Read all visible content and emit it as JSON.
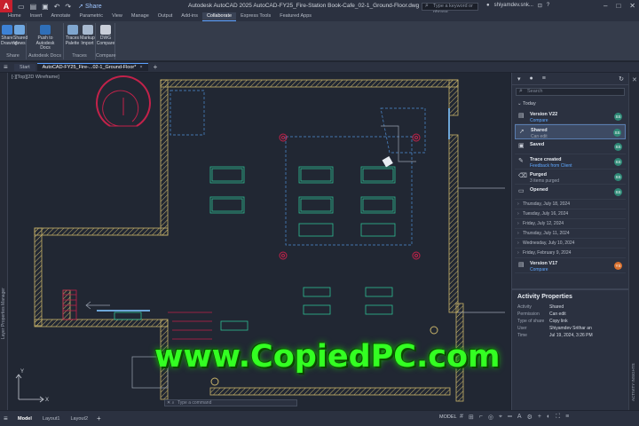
{
  "app": {
    "logo": "A",
    "window_title": "Autodesk AutoCAD 2025    AutoCAD-FY25_Fire-Station Book-Cafe_02-1_Ground-Floor.dwg",
    "share_label": "Share",
    "search_placeholder": "Type a keyword or phrase",
    "user_name": "shiyamdev.snk..."
  },
  "ribbon": {
    "tabs": [
      "Home",
      "Insert",
      "Annotate",
      "Parametric",
      "View",
      "Manage",
      "Output",
      "Add-ins",
      "Collaborate",
      "Express Tools",
      "Featured Apps"
    ],
    "active_tab": "Collaborate",
    "groups": [
      {
        "label": "Share",
        "buttons": [
          {
            "label": "Share Drawing"
          },
          {
            "label": "Shared Views"
          }
        ]
      },
      {
        "label": "Autodesk Docs",
        "buttons": [
          {
            "label": "Push to Autodesk Docs"
          }
        ]
      },
      {
        "label": "Traces",
        "buttons": [
          {
            "label": "Traces Palette"
          },
          {
            "label": "Markup Import"
          }
        ]
      },
      {
        "label": "Compare",
        "buttons": [
          {
            "label": "DWG Compare"
          }
        ]
      }
    ]
  },
  "doc_tabs": {
    "start": "Start",
    "active": "AutoCAD-FY25_Fire-...02-1_Ground-Floor*"
  },
  "canvas": {
    "view_label": "[-][Top][2D Wireframe]",
    "command_placeholder": "Type a command"
  },
  "side_labels": {
    "layer_manager": "Layer Properties Manager",
    "activity_insights": "ACTIVITY INSIGHTS"
  },
  "activity": {
    "search_placeholder": "Search",
    "today_label": "Today",
    "items": [
      {
        "title": "Version V22",
        "sub": "Compare",
        "link": true,
        "avatar": "SS",
        "icon": "version-icon",
        "glyph": "▤"
      },
      {
        "title": "Shared",
        "sub": "Can edit",
        "link": false,
        "avatar": "SS",
        "icon": "share-icon",
        "glyph": "➚",
        "selected": true
      },
      {
        "title": "Saved",
        "sub": "",
        "link": false,
        "avatar": "SS",
        "icon": "save-icon",
        "glyph": "▣"
      },
      {
        "title": "Trace created",
        "sub": "Feedback from Client",
        "link": true,
        "avatar": "SS",
        "icon": "trace-icon",
        "glyph": "✎"
      },
      {
        "title": "Purged",
        "sub": "3 items purged",
        "link": false,
        "avatar": "SS",
        "icon": "purge-icon",
        "glyph": "⌫"
      },
      {
        "title": "Opened",
        "sub": "",
        "link": false,
        "avatar": "SS",
        "icon": "open-icon",
        "glyph": "▭"
      }
    ],
    "dates": [
      "Thursday, July 18, 2024",
      "Tuesday, July 16, 2024",
      "Friday, July 12, 2024",
      "Thursday, July 11, 2024",
      "Wednesday, July 10, 2024",
      "Friday, February 9, 2024"
    ],
    "last_item": {
      "title": "Version V17",
      "sub": "Compare",
      "avatar": "YS"
    },
    "properties_title": "Activity Properties",
    "properties": [
      {
        "k": "Activity",
        "v": "Shared"
      },
      {
        "k": "Permission",
        "v": "Can edit"
      },
      {
        "k": "Type of share",
        "v": "Copy link"
      },
      {
        "k": "User",
        "v": "Shiyamdev Srithar an"
      },
      {
        "k": "Time",
        "v": "Jul 19, 2024, 3:26 PM"
      }
    ]
  },
  "status": {
    "tabs": [
      "Model",
      "Layout1",
      "Layout2"
    ],
    "active": "Model",
    "model_label": "MODEL"
  },
  "watermark": "www.CopiedPC.com",
  "colors": {
    "accent": "#5aa0ff",
    "wall": "#c9b46a",
    "stair": "#c2224a",
    "furniture": "#2fbf93",
    "dashed": "#4f8fd6"
  }
}
